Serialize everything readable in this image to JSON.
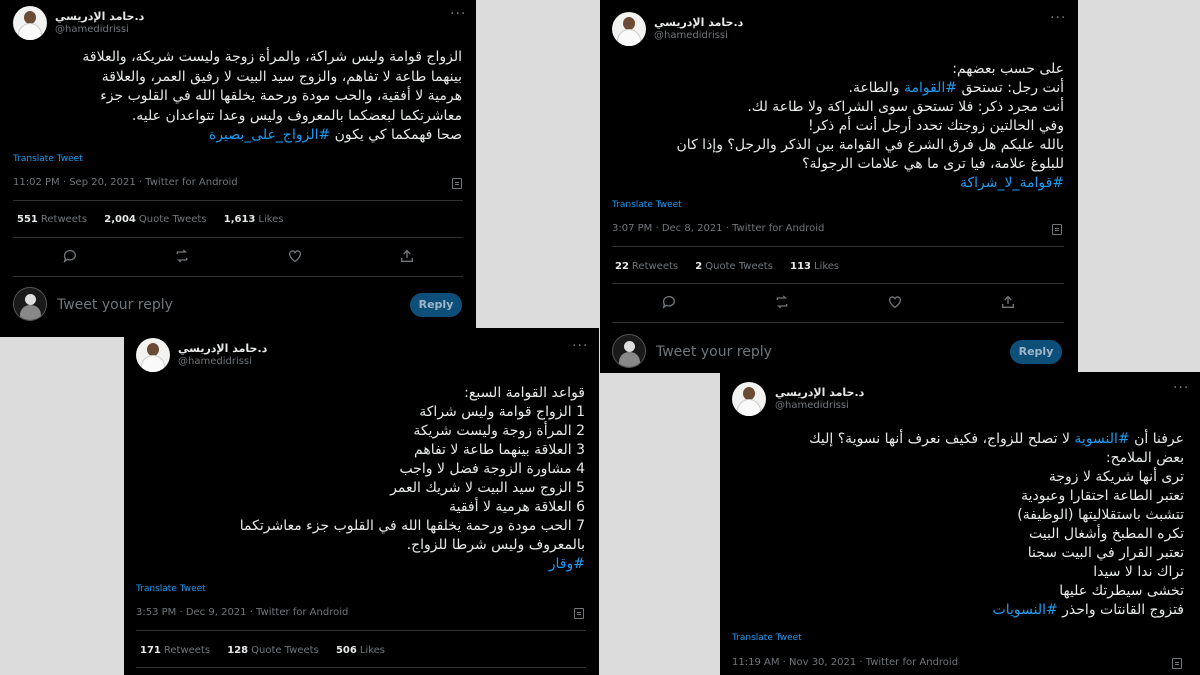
{
  "author": {
    "display_name": "د.حامد الإدريسي",
    "handle": "@hamedidrissi"
  },
  "ui": {
    "translate": "Translate Tweet",
    "retweets": "Retweets",
    "quote_tweets": "Quote Tweets",
    "likes": "Likes",
    "reply_placeholder": "Tweet your reply",
    "reply_button": "Reply",
    "more": "···"
  },
  "tweets": [
    {
      "lines": [
        "الزواج قوامة وليس شراكة، والمرأة زوجة وليست شريكة، والعلاقة",
        "بينهما  طاعة لا تفاهم، والزوج سيد البيت لا رفيق العمر، والعلاقة",
        "هرمية لا أفقية، والحب مودة ورحمة يخلقها الله في القلوب جزء",
        "معاشرتكما لبعضكما بالمعروف وليس وعدا تتواعدان عليه."
      ],
      "last_text": "صحا فهمكما كي يكون ",
      "last_hashtag": "#الزواج_على_بصيرة",
      "time": "11:02 PM · Sep 20, 2021 · Twitter for Android",
      "retweets": "551",
      "quotes": "2,004",
      "likes": "1,613"
    },
    {
      "lines": [
        "على حسب بعضهم:",
        "أنت رجل: تستحق #القوامة والطاعة.",
        "أنت مجرد ذكر: فلا تستحق سوى الشراكة ولا طاعة لك.",
        "وفي الحالتين زوجتك تحدد أرجل أنت أم ذكر!",
        "بالله عليكم هل فرق الشرع في القوامة بين الذكر والرجل؟ وإذا كان",
        "للبلوغ علامة، فيا ترى ما هي علامات الرجولة؟"
      ],
      "line2_prefix": "أنت رجل: تستحق ",
      "line2_hashtag": "#القوامة",
      "line2_suffix": " والطاعة.",
      "last_hashtag": "#قوامة_لا_شراكة",
      "time": "3:07 PM · Dec 8, 2021 · Twitter for Android",
      "retweets": "22",
      "quotes": "2",
      "likes": "113"
    },
    {
      "lines": [
        "قواعد القوامة السبع:",
        "1 الزواج قوامة وليس شراكة",
        "2 المرأة زوجة وليست شريكة",
        "3 العلاقة بينهما طاعة لا تفاهم",
        "4 مشاورة الزوجة فضل لا واجب",
        "5 الزوج سيد البيت لا شريك العمر",
        "6 العلاقة هرمية لا أفقية",
        "7 الحب مودة ورحمة يخلقها الله في القلوب جزء معاشرتكما",
        "بالمعروف وليس شرطا للزواج."
      ],
      "last_hashtag": "#وقار",
      "time": "3:53 PM · Dec 9, 2021 · Twitter for Android",
      "retweets": "171",
      "quotes": "128",
      "likes": "506"
    },
    {
      "line1_prefix": "عرفنا أن ",
      "line1_hashtag": "#النسوية",
      "line1_suffix": " لا تصلح للزواج، فكيف نعرف أنها نسوية؟ إليك",
      "lines": [
        "بعض الملامح:",
        "ترى أنها شريكة لا زوجة",
        "تعتبر الطاعة احتقارا وعبودية",
        "تتشبث باستقلاليتها (الوظيفة)",
        "تكره المطبخ وأشغال البيت",
        "تعتبر القرار في البيت سجنا",
        "تراك ندا لا سيدا",
        "تخشى سيطرتك عليها"
      ],
      "last_text": "فتزوج القانتات واحذر ",
      "last_hashtag": "#النسويات",
      "time": "11:19 AM · Nov 30, 2021 · Twitter for Android"
    }
  ]
}
